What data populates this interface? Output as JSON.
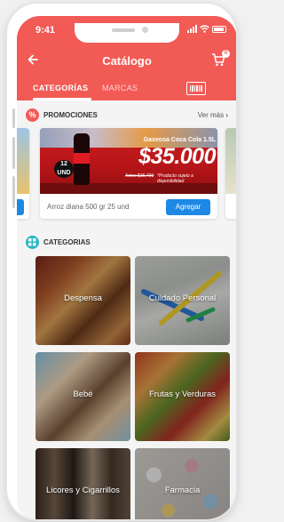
{
  "status": {
    "time": "9:41"
  },
  "header": {
    "back_icon": "arrow-left-icon",
    "title": "Catálogo",
    "cart_icon": "cart-icon",
    "cart_count": "0"
  },
  "tabs": [
    {
      "label": "CATEGORÍAS",
      "active": true
    },
    {
      "label": "MARCAS",
      "active": false
    }
  ],
  "barcode_icon": "barcode-icon",
  "promotions": {
    "section_icon": "percent-icon",
    "title": "PROMOCIONES",
    "see_more": "Ver más",
    "see_more_icon": "chevron-right-icon",
    "card": {
      "brand_text": "Gaseosa Coca Cola 1.5L",
      "price": "$35.000",
      "old_price": "Antes $36.700",
      "note": "*Producto sujeto a disponibilidad",
      "units_badge": "12 UND",
      "product_name": "Arroz diana 500 gr 25 und",
      "add_label": "Agregar"
    }
  },
  "categories": {
    "section_icon": "grid-icon",
    "title": "CATEGORIAS",
    "items": [
      {
        "label": "Despensa"
      },
      {
        "label": "Cuidado Personal"
      },
      {
        "label": "Bebé"
      },
      {
        "label": "Frutas y Verduras"
      },
      {
        "label": "Licores y Cigarrillos"
      },
      {
        "label": "Farmacia"
      }
    ]
  },
  "colors": {
    "brand": "#f25a55",
    "accent_button": "#1e88e5"
  }
}
